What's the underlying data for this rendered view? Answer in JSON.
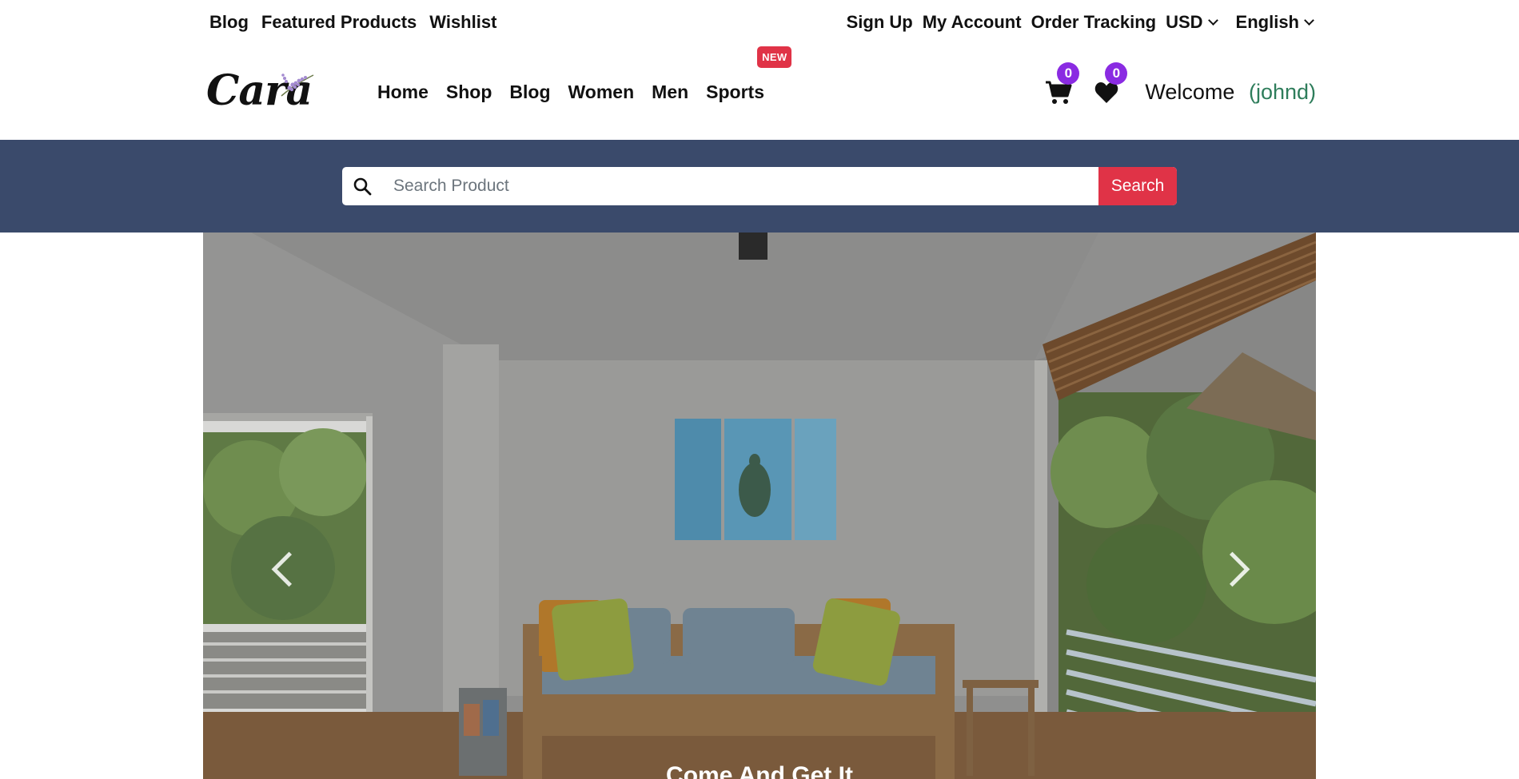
{
  "topbar": {
    "left_links": [
      "Blog",
      "Featured Products",
      "Wishlist"
    ],
    "signup": "Sign Up",
    "account": "My Account",
    "tracking": "Order Tracking",
    "currency": "USD",
    "language": "English"
  },
  "header": {
    "logo_text": "Cara",
    "nav": [
      "Home",
      "Shop",
      "Blog",
      "Women",
      "Men",
      "Sports"
    ],
    "new_badge": "NEW",
    "cart_count": "0",
    "wishlist_count": "0",
    "welcome": "Welcome",
    "username": "(johnd)"
  },
  "search": {
    "placeholder": "Search Product",
    "button": "Search"
  },
  "hero": {
    "caption": "Come And Get It"
  },
  "colors": {
    "search_band": "#3a4a6b",
    "accent_red": "#e03347",
    "badge_purple": "#8a2be2",
    "username_green": "#2e7d5b"
  },
  "icons": [
    "search-icon",
    "cart-icon",
    "heart-icon",
    "chevron-down-icon",
    "chevron-left-icon",
    "chevron-right-icon"
  ]
}
